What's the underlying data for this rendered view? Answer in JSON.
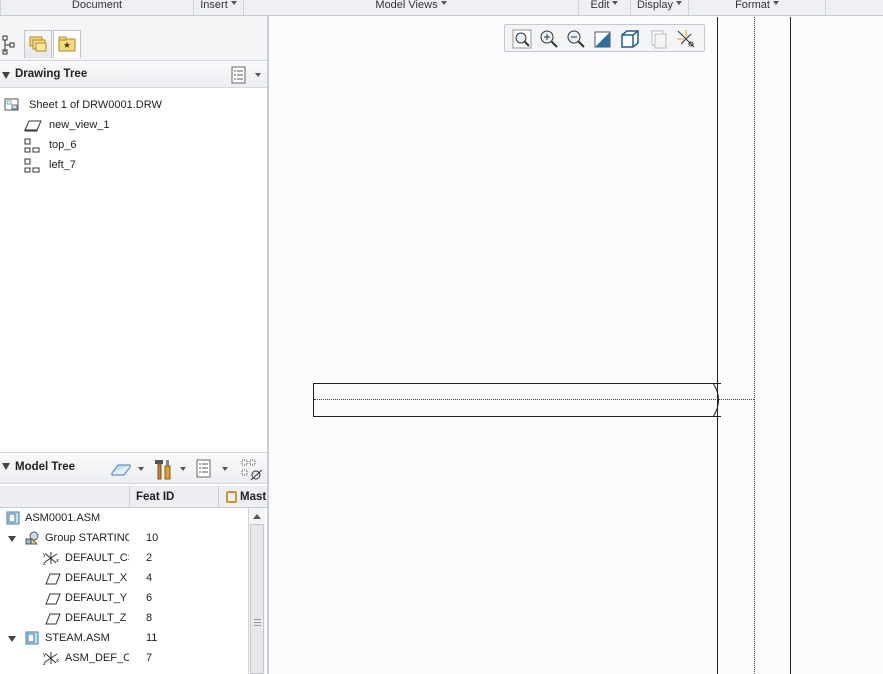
{
  "menubar": {
    "items": [
      {
        "label": "Document",
        "caret": false
      },
      {
        "label": "Insert",
        "caret": true
      },
      {
        "label": "Model Views",
        "caret": true
      },
      {
        "label": "Edit",
        "caret": true
      },
      {
        "label": "Display",
        "caret": true
      },
      {
        "label": "Format",
        "caret": true
      }
    ]
  },
  "panel_tabs": [
    "tree-tab-icon",
    "layers-tab-icon",
    "favorites-tab-icon"
  ],
  "drawing_tree": {
    "title": "Drawing Tree",
    "items": [
      {
        "label": "Sheet 1 of DRW0001.DRW",
        "icon": "sheet-icon"
      },
      {
        "label": "new_view_1",
        "icon": "general-view-icon"
      },
      {
        "label": "top_6",
        "icon": "projection-view-icon"
      },
      {
        "label": "left_7",
        "icon": "projection-view-icon"
      }
    ]
  },
  "model_tree": {
    "title": "Model Tree",
    "columns": {
      "feat_id": "Feat ID",
      "master": "Mast"
    },
    "rows": [
      {
        "label": "ASM0001.ASM",
        "feat": "",
        "icon": "assembly-icon"
      },
      {
        "label": "Group STARTING_",
        "feat": "10",
        "icon": "group-icon"
      },
      {
        "label": "DEFAULT_CS",
        "feat": "2",
        "icon": "csys-icon"
      },
      {
        "label": "DEFAULT_X",
        "feat": "4",
        "icon": "datum-plane-icon"
      },
      {
        "label": "DEFAULT_Y",
        "feat": "6",
        "icon": "datum-plane-icon"
      },
      {
        "label": "DEFAULT_Z",
        "feat": "8",
        "icon": "datum-plane-icon"
      },
      {
        "label": "STEAM.ASM",
        "feat": "11",
        "icon": "assembly-icon"
      },
      {
        "label": "ASM_DEF_CS",
        "feat": "7",
        "icon": "csys-icon"
      }
    ]
  },
  "view_toolbar": [
    "refit-icon",
    "zoom-in-icon",
    "zoom-out-icon",
    "repaint-icon",
    "display-style-icon",
    "saved-views-icon",
    "datum-display-icon"
  ]
}
